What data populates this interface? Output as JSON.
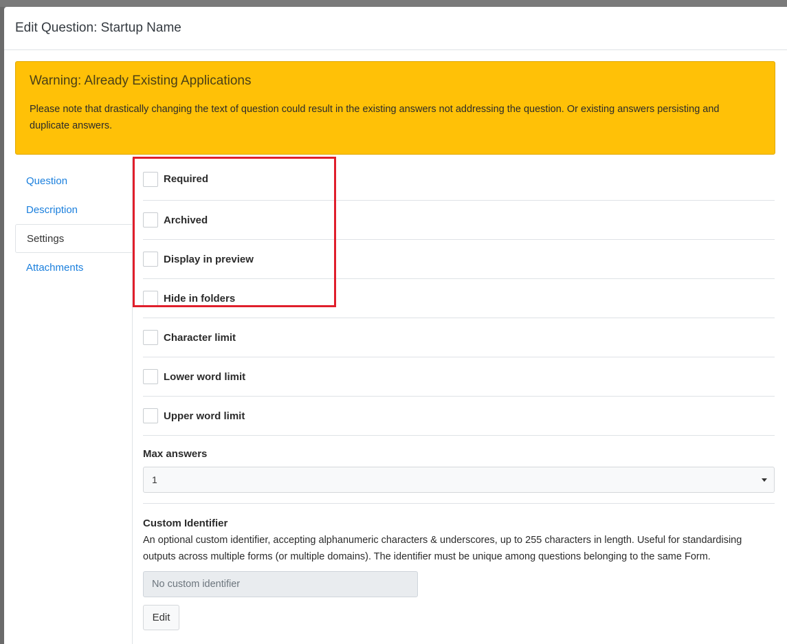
{
  "modal": {
    "title": "Edit Question: Startup Name"
  },
  "warning": {
    "title": "Warning: Already Existing Applications",
    "text": "Please note that drastically changing the text of question could result in the existing answers not addressing the question. Or existing answers persisting and duplicate answers."
  },
  "sidebar": {
    "items": [
      {
        "label": "Question",
        "active": false
      },
      {
        "label": "Description",
        "active": false
      },
      {
        "label": "Settings",
        "active": true
      },
      {
        "label": "Attachments",
        "active": false
      }
    ]
  },
  "settings": {
    "checkboxes": [
      {
        "label": "Required",
        "checked": false
      },
      {
        "label": "Archived",
        "checked": false
      },
      {
        "label": "Display in preview",
        "checked": false
      },
      {
        "label": "Hide in folders",
        "checked": false
      },
      {
        "label": "Character limit",
        "checked": false
      },
      {
        "label": "Lower word limit",
        "checked": false
      },
      {
        "label": "Upper word limit",
        "checked": false
      }
    ],
    "max_answers": {
      "label": "Max answers",
      "value": "1"
    },
    "custom_identifier": {
      "label": "Custom Identifier",
      "description": "An optional custom identifier, accepting alphanumeric characters & underscores, up to 255 characters in length. Useful for standardising outputs across multiple forms (or multiple domains). The identifier must be unique among questions belonging to the same Form.",
      "placeholder": "No custom identifier",
      "edit_label": "Edit"
    }
  },
  "colors": {
    "warning_bg": "#ffc107",
    "link": "#1a7fdd",
    "highlight": "#e01e2b"
  }
}
